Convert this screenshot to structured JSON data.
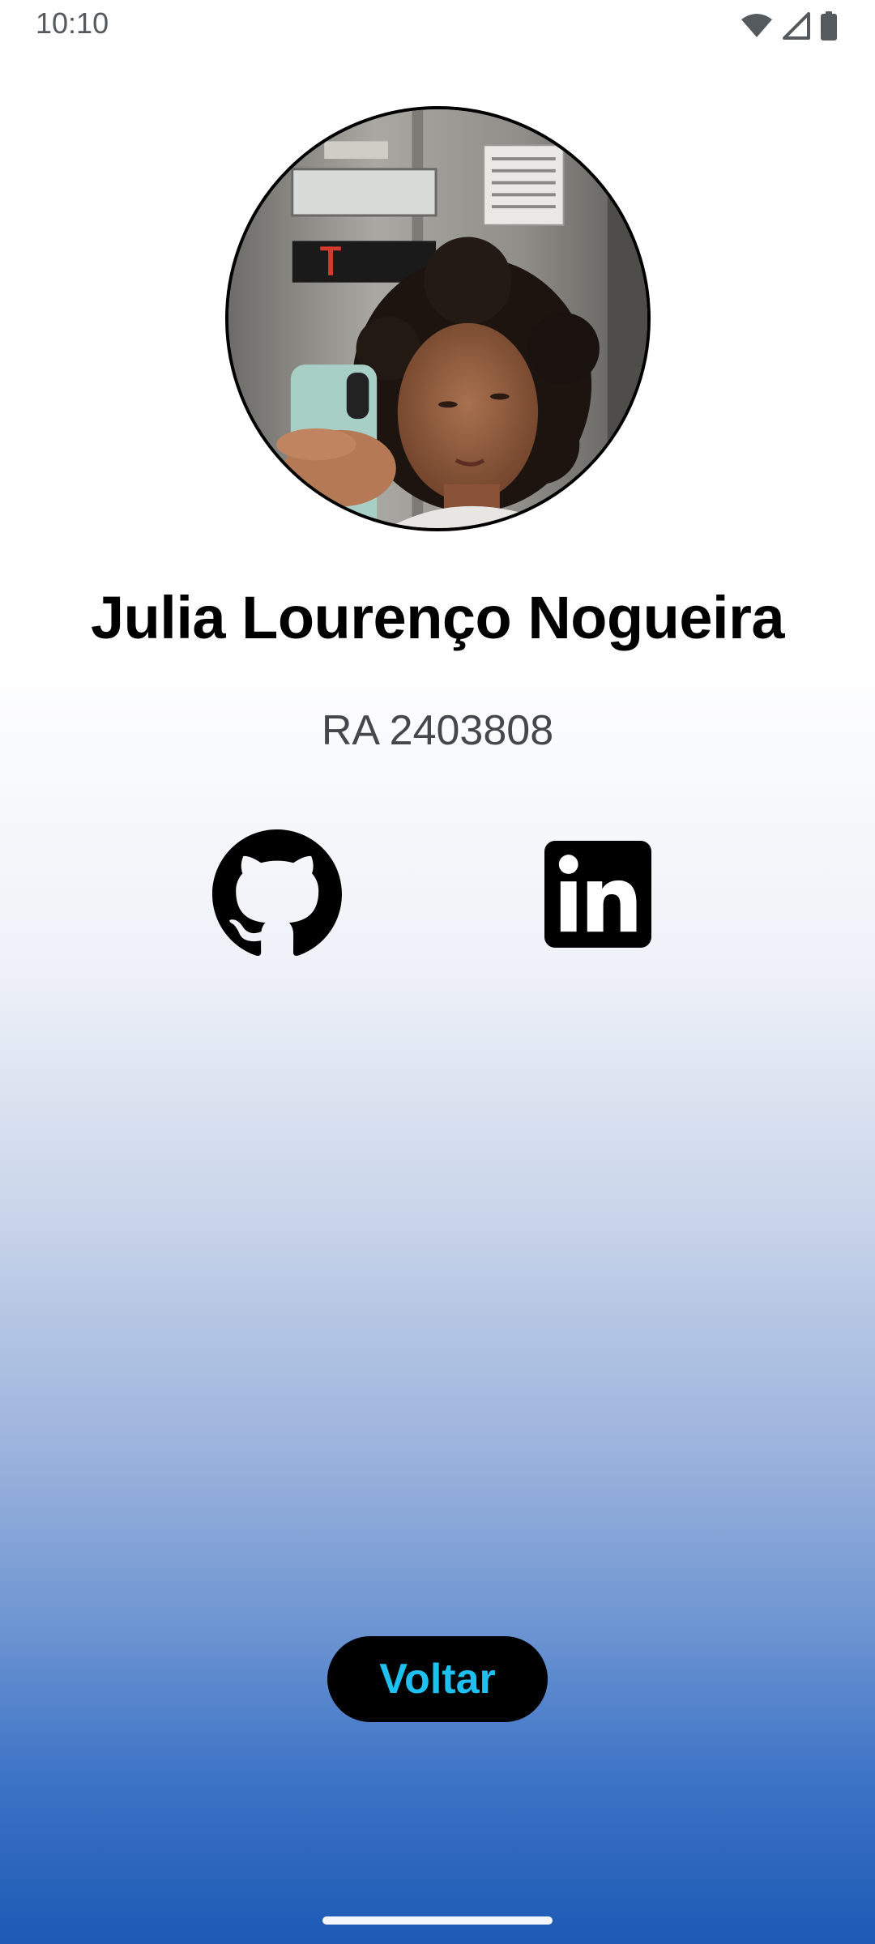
{
  "status_bar": {
    "time": "10:10",
    "icons": [
      "wifi-icon",
      "cellular-signal-icon",
      "battery-icon"
    ]
  },
  "profile": {
    "avatar": "profile-photo",
    "name": "Julia Lourenço Nogueira",
    "ra": "RA 2403808"
  },
  "social": [
    {
      "icon": "github-icon"
    },
    {
      "icon": "linkedin-icon"
    }
  ],
  "actions": {
    "back_label": "Voltar"
  },
  "colors": {
    "button_bg": "#000000",
    "button_text": "#1ec0f0",
    "gradient_top": "#ffffff",
    "gradient_bottom": "#1d5ab4"
  }
}
